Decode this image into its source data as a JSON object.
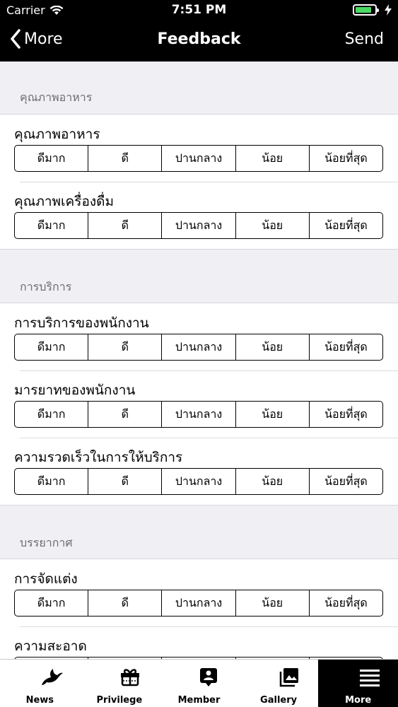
{
  "status_bar": {
    "carrier": "Carrier",
    "time": "7:51 PM",
    "battery_level": 0.85
  },
  "nav": {
    "back_label": "More",
    "title": "Feedback",
    "send_label": "Send"
  },
  "options": [
    "ดีมาก",
    "ดี",
    "ปานกลาง",
    "น้อย",
    "น้อยที่สุด"
  ],
  "sections": [
    {
      "title": "คุณภาพอาหาร",
      "items": [
        "คุณภาพอาหาร",
        "คุณภาพเครื่องดื่ม"
      ]
    },
    {
      "title": "การบริการ",
      "items": [
        "การบริการของพนักงาน",
        "มารยาทของพนักงาน",
        "ความรวดเร็วในการให้บริการ"
      ]
    },
    {
      "title": "บรรยากาศ",
      "items": [
        "การจัดแต่ง",
        "ความสะอาด"
      ]
    }
  ],
  "tabs": [
    {
      "label": "News",
      "icon": "bird-icon",
      "active": false
    },
    {
      "label": "Privilege",
      "icon": "gift-icon",
      "active": false
    },
    {
      "label": "Member",
      "icon": "member-card-icon",
      "active": false
    },
    {
      "label": "Gallery",
      "icon": "gallery-icon",
      "active": false
    },
    {
      "label": "More",
      "icon": "menu-lines-icon",
      "active": true
    }
  ]
}
